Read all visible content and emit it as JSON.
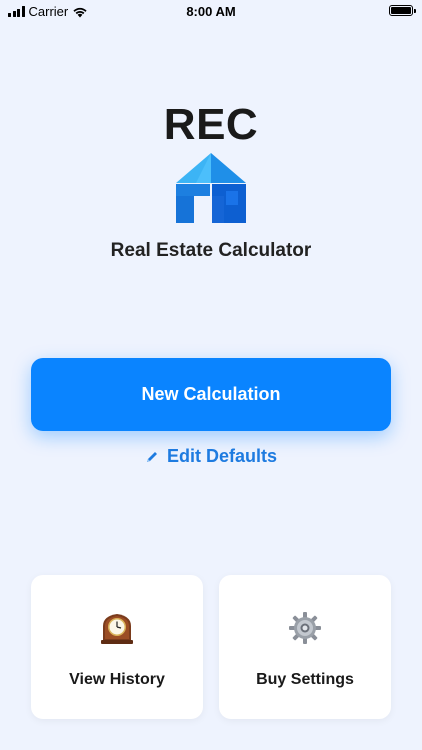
{
  "status_bar": {
    "carrier": "Carrier",
    "time": "8:00 AM"
  },
  "header": {
    "logo_text": "REC",
    "app_name": "Real Estate Calculator"
  },
  "actions": {
    "new_calculation_label": "New Calculation",
    "edit_defaults_label": "Edit Defaults"
  },
  "cards": {
    "history_label": "View History",
    "settings_label": "Buy Settings"
  },
  "colors": {
    "accent": "#0a84ff",
    "link": "#1e7be0",
    "background": "#eef3fe"
  },
  "icons": {
    "logo": "house-logo-icon",
    "edit": "pencil-icon",
    "history": "mantel-clock-icon",
    "settings": "gear-icon"
  }
}
